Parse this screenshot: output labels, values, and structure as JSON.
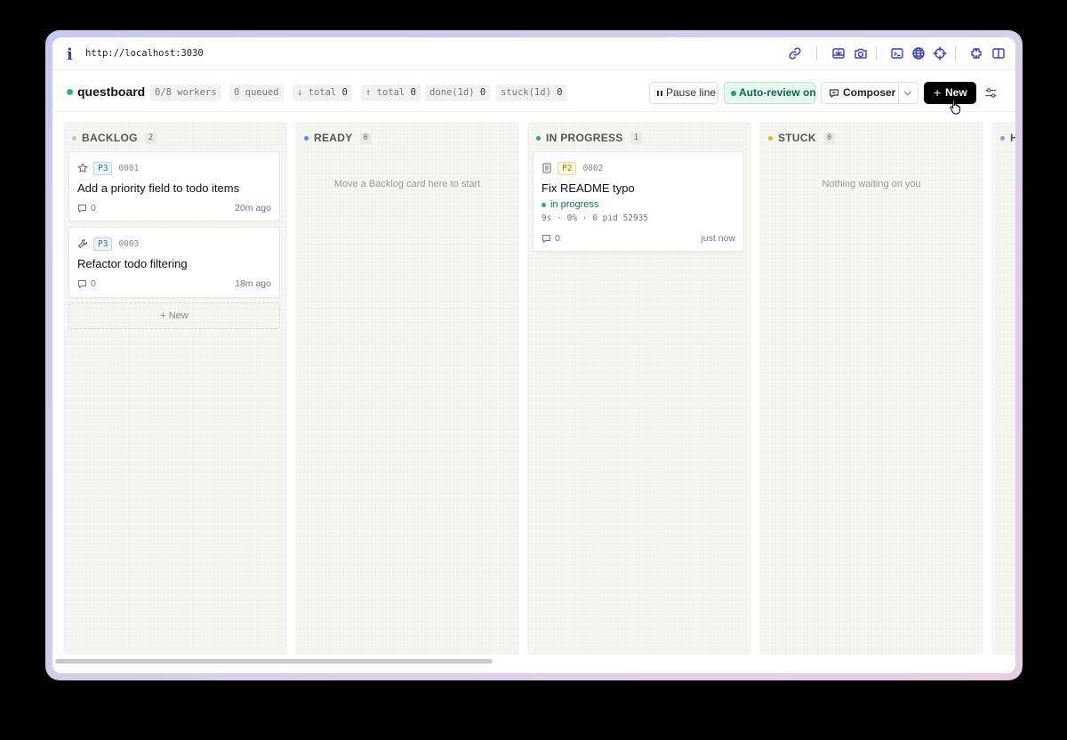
{
  "browser": {
    "url": "http://localhost:3030",
    "icons": [
      "link-icon",
      "inspect-icon",
      "camera-icon",
      "terminal-icon",
      "globe-icon",
      "crosshair-icon",
      "extension-icon",
      "sidebar-icon"
    ]
  },
  "header": {
    "brand": "questboard",
    "stats": [
      {
        "label": "0/8 workers"
      },
      {
        "label": "0 queued"
      },
      {
        "label": "↓ total ",
        "value": "0"
      },
      {
        "label": "↑ total ",
        "value": "0"
      },
      {
        "label": "done(1d) ",
        "value": "0"
      },
      {
        "label": "stuck(1d) ",
        "value": "0"
      }
    ],
    "pause_label": "Pause line",
    "auto_review_label": "Auto-review on",
    "composer_label": "Composer",
    "new_label": "New"
  },
  "columns": [
    {
      "title": "BACKLOG",
      "count": "2",
      "color": "#c4c4c4",
      "empty": ""
    },
    {
      "title": "READY",
      "count": "0",
      "color": "#4f8ff7",
      "empty": "Move a Backlog card here to start"
    },
    {
      "title": "IN PROGRESS",
      "count": "1",
      "color": "#27b074",
      "empty": ""
    },
    {
      "title": "STUCK",
      "count": "0",
      "color": "#f0a93a",
      "empty": "Nothing waiting on you"
    },
    {
      "title": "H",
      "count": "",
      "color": "#a48ef0",
      "empty": ""
    }
  ],
  "cards": {
    "c1": {
      "priority": "P3",
      "id": "0001",
      "title": "Add a priority field to todo items",
      "comments": "0",
      "age": "20m ago",
      "icon": "star-icon"
    },
    "c2": {
      "priority": "P3",
      "id": "0003",
      "title": "Refactor todo filtering",
      "comments": "0",
      "age": "18m ago",
      "icon": "wrench-icon"
    },
    "c3": {
      "priority": "P2",
      "id": "0002",
      "title": "Fix README typo",
      "status": "in progress",
      "process": "9s · 0% · 0 pid 52935",
      "comments": "0",
      "age": "just now",
      "icon": "document-icon"
    }
  },
  "backlog_new_label": "+ New",
  "colors": {
    "accent_green": "#2fb37c",
    "new_button": "#000000"
  }
}
